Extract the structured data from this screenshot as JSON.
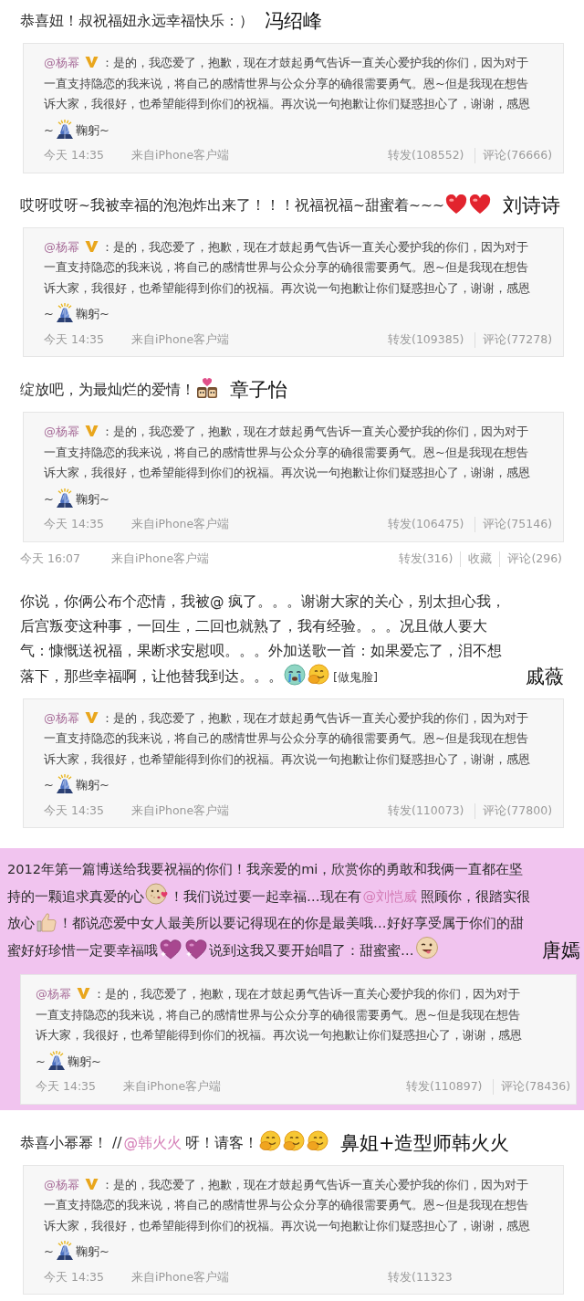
{
  "posts": [
    {
      "highlighted": false,
      "comment": [
        {
          "kind": "text",
          "text": "恭喜妞！叔祝福妞永远幸福快乐：）"
        }
      ],
      "name": "冯绍峰",
      "repost": {
        "author": "@杨幂",
        "text": "：是的，我恋爱了，抱歉，现在才鼓起勇气告诉一直关心爱护我的你们，因为对于一直支持隐恋的我来说，将自己的感情世界与公众分享的确很需要勇气。恩~但是我现在想告诉大家，我很好，也希望能得到你们的祝福。再次说一句抱歉让你们疑惑担心了，谢谢，感恩",
        "closing_start": "~",
        "closing_end": "鞠躬~",
        "time": "今天 14:35",
        "source": "来自iPhone客户端",
        "actions": [
          "转发(108552)",
          "评论(76666)"
        ]
      }
    },
    {
      "highlighted": false,
      "comment": [
        {
          "kind": "text",
          "text": "哎呀哎呀~我被幸福的泡泡炸出来了！！！祝福祝福~甜蜜着~~~"
        },
        {
          "kind": "heart"
        },
        {
          "kind": "heart"
        }
      ],
      "name": "刘诗诗",
      "repost": {
        "author": "@杨幂",
        "text": "：是的，我恋爱了，抱歉，现在才鼓起勇气告诉一直关心爱护我的你们，因为对于一直支持隐恋的我来说，将自己的感情世界与公众分享的确很需要勇气。恩~但是我现在想告诉大家，我很好，也希望能得到你们的祝福。再次说一句抱歉让你们疑惑担心了，谢谢，感恩",
        "closing_start": "~",
        "closing_end": "鞠躬~",
        "time": "今天 14:35",
        "source": "来自iPhone客户端",
        "actions": [
          "转发(109385)",
          "评论(77278)"
        ]
      }
    },
    {
      "highlighted": false,
      "comment": [
        {
          "kind": "text",
          "text": "绽放吧，为最灿烂的爱情！"
        },
        {
          "kind": "couple"
        }
      ],
      "name": "章子怡",
      "repost": {
        "author": "@杨幂",
        "text": "：是的，我恋爱了，抱歉，现在才鼓起勇气告诉一直关心爱护我的你们，因为对于一直支持隐恋的我来说，将自己的感情世界与公众分享的确很需要勇气。恩~但是我现在想告诉大家，我很好，也希望能得到你们的祝福。再次说一句抱歉让你们疑惑担心了，谢谢，感恩",
        "closing_start": "~",
        "closing_end": "鞠躬~",
        "time": "今天 14:35",
        "source": "来自iPhone客户端",
        "actions": [
          "转发(106475)",
          "评论(75146)"
        ]
      },
      "footer": {
        "time": "今天 16:07",
        "source": "来自iPhone客户端",
        "actions": [
          "转发(316)",
          "收藏",
          "评论(296)"
        ]
      }
    },
    {
      "highlighted": false,
      "comment": [
        {
          "kind": "text",
          "text": "你说，你俩公布个恋情，我被@ 疯了。。。谢谢大家的关心，别太担心我，后宫叛变这种事，一回生，二回也就熟了，我有经验。。。况且做人要大气：慷慨送祝福，果断求安慰呗。。。外加送歌一首：如果爱忘了，泪不想落下，那些幸福啊，让他替我到达。。。"
        },
        {
          "kind": "cry"
        },
        {
          "kind": "giggle"
        },
        {
          "kind": "tag",
          "text": "[做鬼脸]"
        }
      ],
      "name": "戚薇",
      "repost": {
        "author": "@杨幂",
        "text": "：是的，我恋爱了，抱歉，现在才鼓起勇气告诉一直关心爱护我的你们，因为对于一直支持隐恋的我来说，将自己的感情世界与公众分享的确很需要勇气。恩~但是我现在想告诉大家，我很好，也希望能得到你们的祝福。再次说一句抱歉让你们疑惑担心了，谢谢，感恩",
        "closing_start": "~",
        "closing_end": "鞠躬~",
        "time": "今天 14:35",
        "source": "来自iPhone客户端",
        "actions": [
          "转发(110073)",
          "评论(77800)"
        ]
      }
    },
    {
      "highlighted": true,
      "comment": [
        {
          "kind": "text",
          "text": "2012年第一篇博送给我要祝福的你们！我亲爱的mi，欣赏你的勇敢和我俩一直都在坚持的一颗追求真爱的心"
        },
        {
          "kind": "kiss"
        },
        {
          "kind": "text",
          "text": "！我们说过要一起幸福…现在有"
        },
        {
          "kind": "mention",
          "text": "@刘恺威"
        },
        {
          "kind": "text",
          "text": "照顾你，很踏实很放心"
        },
        {
          "kind": "thumb"
        },
        {
          "kind": "text",
          "text": "！都说恋爱中女人最美所以要记得现在的你是最美哦…好好享受属于你们的甜蜜好好珍惜一定要幸福哦"
        },
        {
          "kind": "glitterheart"
        },
        {
          "kind": "glitterheart"
        },
        {
          "kind": "text",
          "text": "说到这我又要开始唱了：甜蜜蜜…"
        },
        {
          "kind": "wink"
        }
      ],
      "name": "唐嫣",
      "repost": {
        "author": "@杨幂",
        "text": "：是的，我恋爱了，抱歉，现在才鼓起勇气告诉一直关心爱护我的你们，因为对于一直支持隐恋的我来说，将自己的感情世界与公众分享的确很需要勇气。恩~但是我现在想告诉大家，我很好，也希望能得到你们的祝福。再次说一句抱歉让你们疑惑担心了，谢谢，感恩",
        "closing_start": "~",
        "closing_end": "鞠躬~",
        "time": "今天 14:35",
        "source": "来自iPhone客户端",
        "actions": [
          "转发(110897)",
          "评论(78436)"
        ]
      }
    },
    {
      "highlighted": false,
      "comment": [
        {
          "kind": "text",
          "text": "恭喜小幂幂！ //"
        },
        {
          "kind": "mention",
          "text": "@韩火火"
        },
        {
          "kind": "text",
          "text": "呀！请客！"
        },
        {
          "kind": "giggle"
        },
        {
          "kind": "giggle"
        },
        {
          "kind": "giggle"
        }
      ],
      "name": "鼻姐+造型师韩火火",
      "repost": {
        "author": "@杨幂",
        "text": "：是的，我恋爱了，抱歉，现在才鼓起勇气告诉一直关心爱护我的你们，因为对于一直支持隐恋的我来说，将自己的感情世界与公众分享的确很需要勇气。恩~但是我现在想告诉大家，我很好，也希望能得到你们的祝福。再次说一句抱歉让你们疑惑担心了，谢谢，感恩",
        "closing_start": "~",
        "closing_end": "鞠躬~",
        "time": "今天 14:35",
        "source": "来自iPhone客户端",
        "actions": [
          "转发(11323"
        ]
      }
    }
  ]
}
